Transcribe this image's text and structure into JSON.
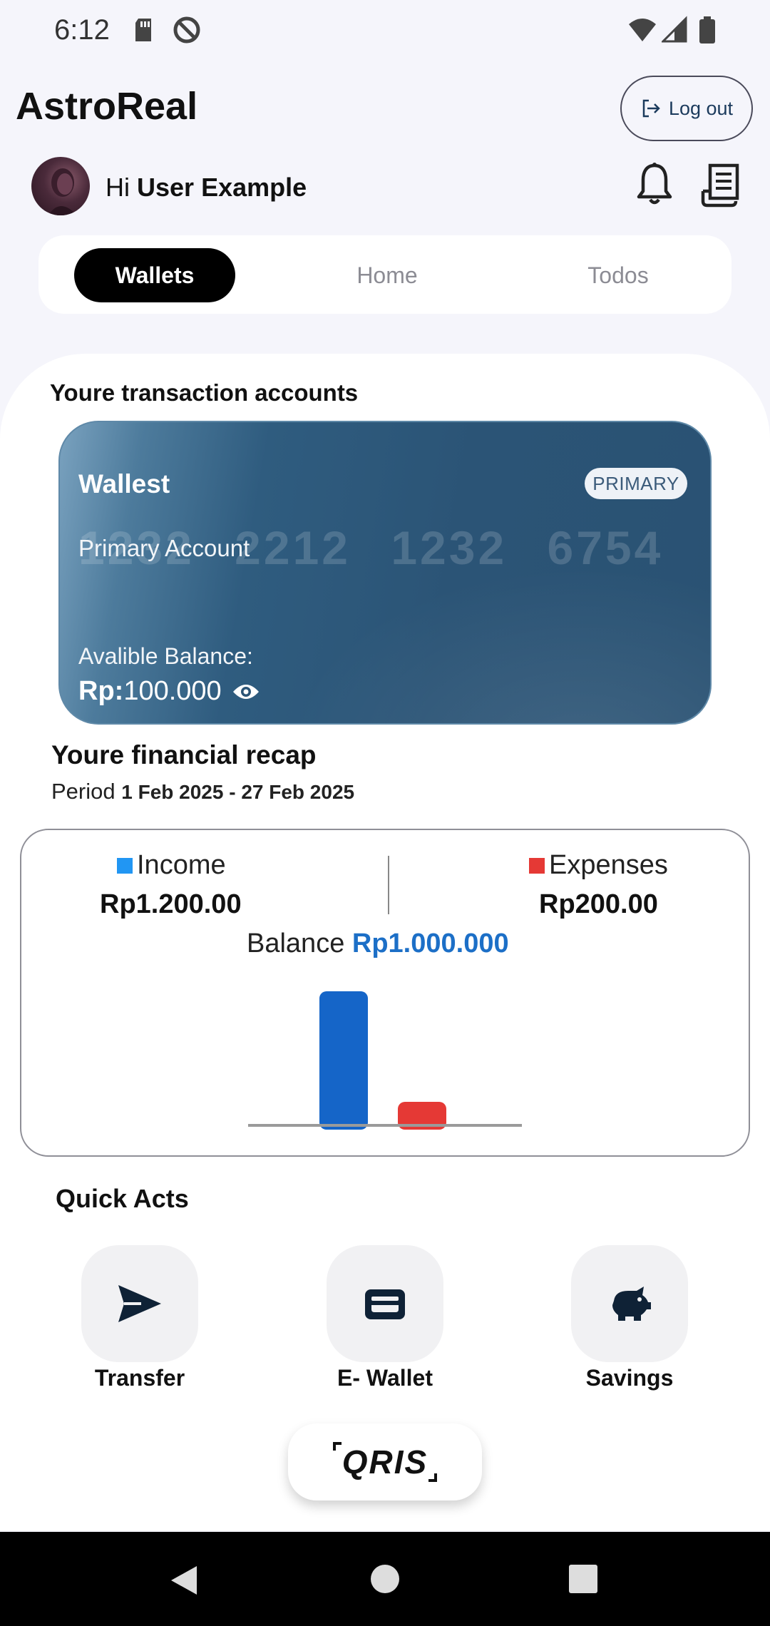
{
  "status_bar": {
    "time": "6:12"
  },
  "header": {
    "app_title": "AstroReal",
    "logout_label": "Log out",
    "greeting_prefix": "Hi",
    "user_name": "User Example"
  },
  "tabs": [
    {
      "label": "Wallets",
      "active": true
    },
    {
      "label": "Home",
      "active": false
    },
    {
      "label": "Todos",
      "active": false
    }
  ],
  "accounts": {
    "section_title": "Youre transaction accounts",
    "card": {
      "name": "Wallest",
      "badge": "PRIMARY",
      "number": "1232 2212 1232 6754",
      "type": "Primary Account",
      "balance_label": "Avalible Balance:",
      "balance_currency": "Rp:",
      "balance_value": "100.000"
    }
  },
  "recap": {
    "title": "Youre financial recap",
    "period_label": "Period",
    "period_range": "1 Feb 2025 - 27 Feb 2025",
    "income_label": "Income",
    "income_value": "Rp1.200.00",
    "expenses_label": "Expenses",
    "expenses_value": "Rp200.00",
    "balance_label": "Balance",
    "balance_value": "Rp1.000.000",
    "colors": {
      "income": "#1565c8",
      "expenses": "#e53935",
      "income_legend": "#2196f3",
      "balance": "#1c6fc7"
    }
  },
  "chart_data": {
    "type": "bar",
    "categories": [
      "Income",
      "Expenses"
    ],
    "values": [
      1200,
      200
    ],
    "colors": [
      "#1565c8",
      "#e53935"
    ],
    "grid": false
  },
  "quick_acts": {
    "title": "Quick Acts",
    "items": [
      {
        "label": "Transfer",
        "icon": "send-icon"
      },
      {
        "label": "E- Wallet",
        "icon": "wallet-icon"
      },
      {
        "label": "Savings",
        "icon": "piggy-bank-icon"
      }
    ]
  },
  "qris": {
    "label": "QRIS"
  }
}
